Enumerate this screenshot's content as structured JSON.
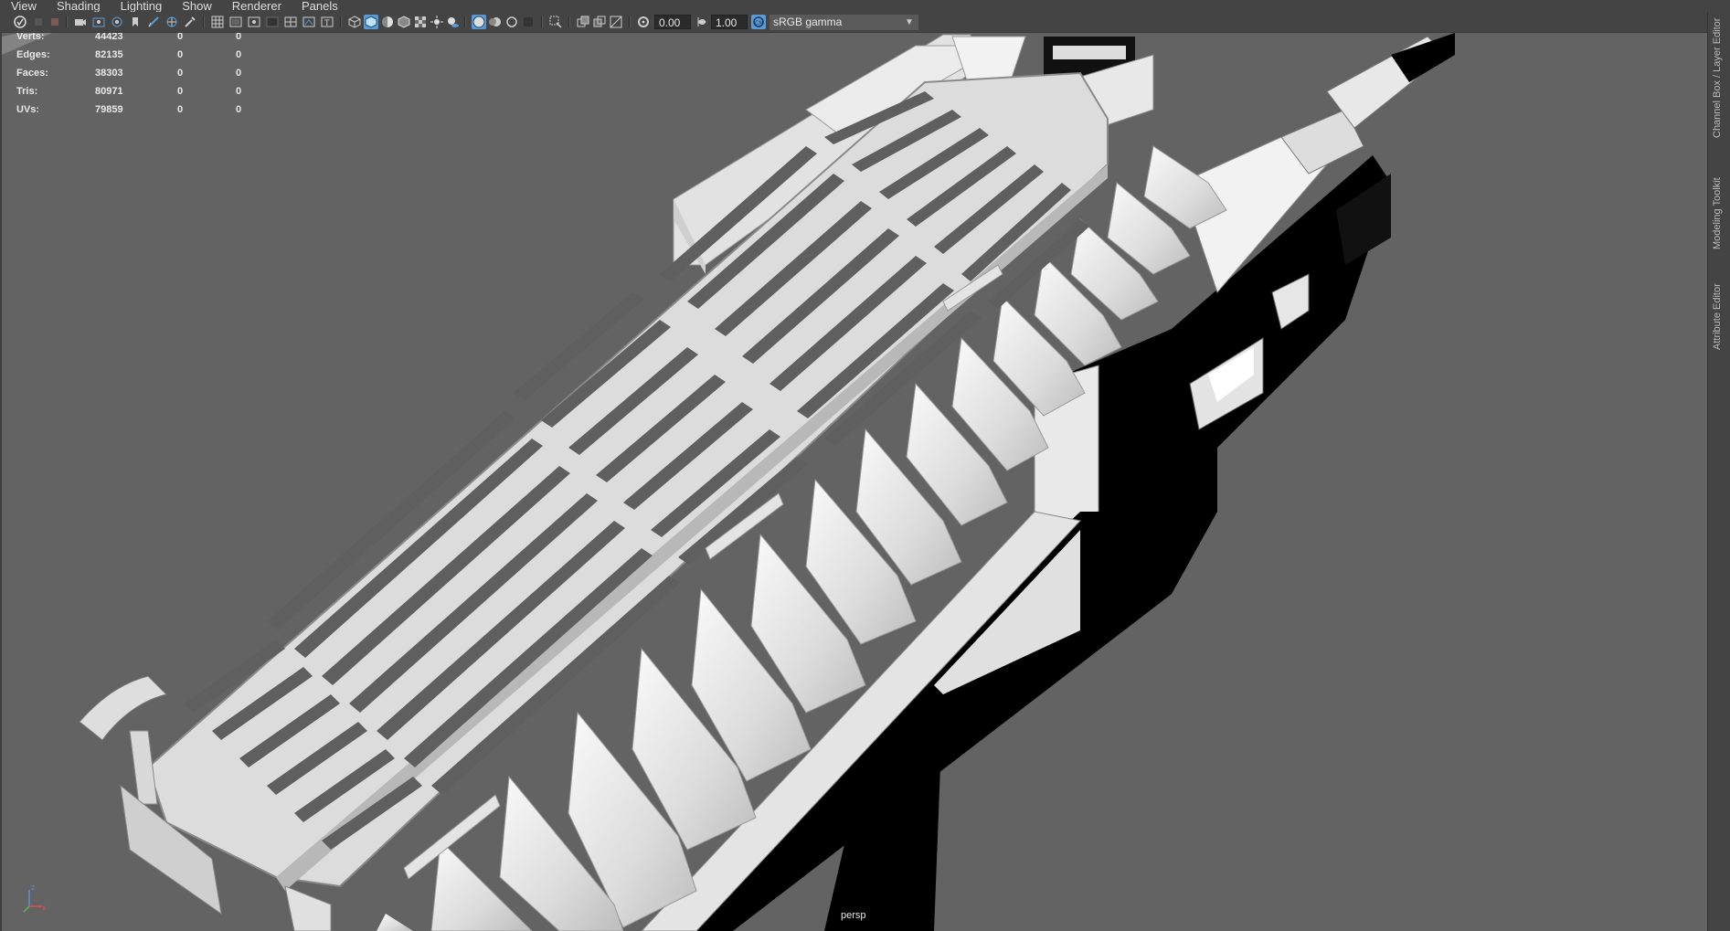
{
  "menu": [
    "View",
    "Shading",
    "Lighting",
    "Show",
    "Renderer",
    "Panels"
  ],
  "toolbar": {
    "exposure_value": "0.00",
    "gamma_value": "1.00",
    "color_space": "sRGB gamma"
  },
  "hud": {
    "rows": [
      {
        "label": "Verts:",
        "total": "44423",
        "selected": "0",
        "selected2": "0"
      },
      {
        "label": "Edges:",
        "total": "82135",
        "selected": "0",
        "selected2": "0"
      },
      {
        "label": "Faces:",
        "total": "38303",
        "selected": "0",
        "selected2": "0"
      },
      {
        "label": "Tris:",
        "total": "80971",
        "selected": "0",
        "selected2": "0"
      },
      {
        "label": "UVs:",
        "total": "79859",
        "selected": "0",
        "selected2": "0"
      }
    ]
  },
  "viewport": {
    "camera_label": "persp"
  },
  "side_tabs": [
    "Channel Box / Layer Editor",
    "Modeling Toolkit",
    "Attribute Editor"
  ],
  "colors": {
    "viewport_bg": "#636363",
    "ui_bg": "#444444",
    "accent": "#5b9bd5"
  }
}
